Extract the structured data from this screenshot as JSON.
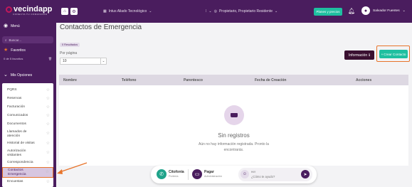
{
  "brand": {
    "name": "vecindapp",
    "tagline": "CONECTA TU COMUNIDAD"
  },
  "sidebar": {
    "menu_label": "Menú",
    "search_placeholder": "Buscar...",
    "favorites_label": "Favoritos",
    "favorites_count": "0 de 5 favoritos",
    "options_label": "Mis Opciones",
    "items": [
      {
        "label": "PQRS"
      },
      {
        "label": "Reservas"
      },
      {
        "label": "Facturación"
      },
      {
        "label": "Comunicados"
      },
      {
        "label": "Documentos"
      },
      {
        "label": "Llamados de atención"
      },
      {
        "label": "Historial de visitas"
      },
      {
        "label": "Autorización visitantes"
      },
      {
        "label": "Correspondencia"
      },
      {
        "label": "Contactos Emergencia"
      },
      {
        "label": "Encuestas"
      }
    ]
  },
  "topbar": {
    "property": "Intus Aliado Tecnológico",
    "role": "Propietario, Propietario Residente",
    "plans_button": "Planes y precios",
    "user_name": "Salvador Fuentes"
  },
  "main": {
    "title": "Contactos de Emergencia",
    "results_badge": "0 Resultados",
    "per_page_label": "Por página",
    "per_page_value": "10",
    "info_button": "Información",
    "create_button": "Crear Contacto",
    "columns": [
      "Nombre",
      "Teléfono",
      "Parentesco",
      "Fecha de Creación",
      "Acciones"
    ],
    "empty_title": "Sin registros",
    "empty_line1": "Aún no hay información registrada. Pronto la",
    "empty_line2": "encontrarás."
  },
  "bottom_bar": {
    "citofonia": "Citofonía",
    "citofonia_sub": "Portería",
    "pagar": "Pagar",
    "pagar_sub": "Administración",
    "assistant_hi": "Hi !!",
    "assistant_prompt": "¿Cómo te ayudo?"
  },
  "colors": {
    "primary": "#4a1d5e",
    "accent": "#1fbfa0",
    "highlight": "#e8742b"
  }
}
